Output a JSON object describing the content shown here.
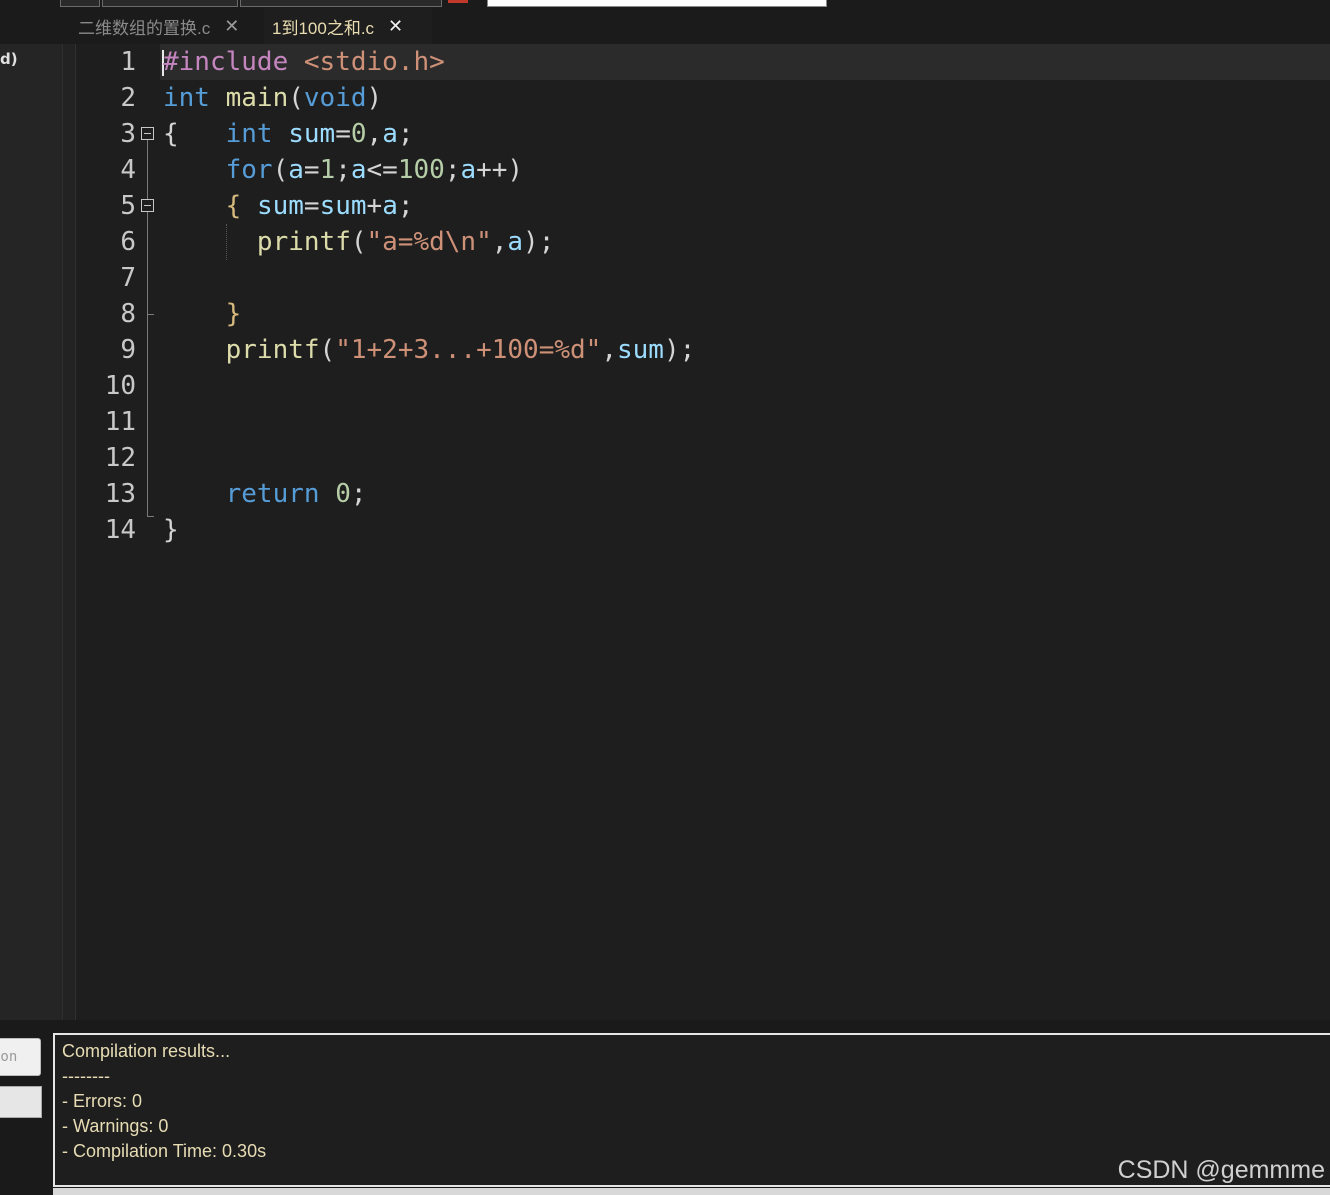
{
  "left_panel": {
    "label": "d)"
  },
  "tabs": [
    {
      "label": "二维数组的置换.c",
      "close": "✕",
      "active": false
    },
    {
      "label": "1到100之和.c",
      "close": "✕",
      "active": true
    }
  ],
  "editor": {
    "line_numbers": [
      "1",
      "2",
      "3",
      "4",
      "5",
      "6",
      "7",
      "8",
      "9",
      "10",
      "11",
      "12",
      "13",
      "14"
    ]
  },
  "output": {
    "lines": [
      "Compilation results...",
      "--------",
      "- Errors: 0",
      "- Warnings: 0",
      "- Compilation Time: 0.30s"
    ],
    "side_button_label": "ion"
  },
  "watermark": "CSDN @gemmme",
  "colors": {
    "background": "#1e1e1e",
    "keyword": "#569cd6",
    "preprocessor": "#c586c0",
    "string": "#ce9178",
    "function": "#dcdcaa",
    "variable": "#9cdcfe",
    "number": "#b5cea8"
  }
}
